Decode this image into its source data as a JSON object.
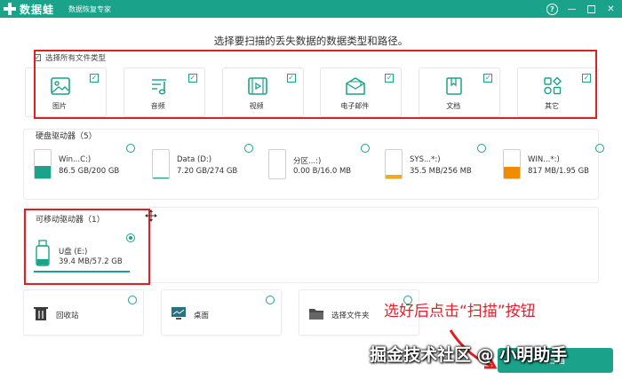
{
  "titlebar": {
    "app_name": "数据蛙",
    "subtitle": "数据恢复专家",
    "help": "?",
    "minimize": "—",
    "close": "✕"
  },
  "heading": "选择要扫描的丢失数据的数据类型和路径。",
  "categories": {
    "select_all_label": "选择所有文件类型",
    "select_all_check": "✓",
    "items": [
      {
        "label": "图片",
        "icon": "image-icon",
        "checked": "✓"
      },
      {
        "label": "音频",
        "icon": "audio-icon",
        "checked": "✓"
      },
      {
        "label": "视频",
        "icon": "video-icon",
        "checked": "✓"
      },
      {
        "label": "电子邮件",
        "icon": "email-icon",
        "checked": "✓"
      },
      {
        "label": "文档",
        "icon": "document-icon",
        "checked": "✓"
      },
      {
        "label": "其它",
        "icon": "other-icon",
        "checked": "✓"
      }
    ]
  },
  "hard_drives": {
    "title": "硬盘驱动器（5）",
    "items": [
      {
        "name": "Win...C:)",
        "size": "86.5 GB/200 GB",
        "fill_fraction": 0.43,
        "fill_color": "#1aa38a"
      },
      {
        "name": "Data (D:)",
        "size": "7.20 GB/274 GB",
        "fill_fraction": 0.03,
        "fill_color": "#1aa38a"
      },
      {
        "name": "分区...:)",
        "size": "0.00  B/16.0 MB",
        "fill_fraction": 0.0,
        "fill_color": "#1aa38a"
      },
      {
        "name": "SYS...*:)",
        "size": "35.5 MB/256 MB",
        "fill_fraction": 0.14,
        "fill_color": "#f5a623"
      },
      {
        "name": "WIN...*:)",
        "size": "817 MB/1.95 GB",
        "fill_fraction": 0.42,
        "fill_color": "#f08c00"
      }
    ]
  },
  "removable": {
    "title": "可移动驱动器（1）",
    "items": [
      {
        "name": "U盘 (E:)",
        "size": "39.4 MB/57.2 GB",
        "selected": true
      }
    ]
  },
  "locations": [
    {
      "label": "回收站",
      "icon": "recycle-bin-icon"
    },
    {
      "label": "桌面",
      "icon": "desktop-icon"
    },
    {
      "label": "选择文件夹",
      "icon": "folder-icon"
    }
  ],
  "annotation": "选好后点击“扫描”按钮",
  "scan_button": "扫描",
  "watermark": "掘金技术社区 @ 小明助手",
  "colors": {
    "accent": "#1aa38a",
    "annotation_red": "#e02020"
  }
}
